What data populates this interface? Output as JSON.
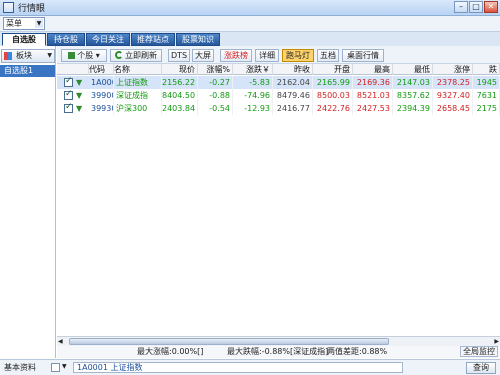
{
  "window": {
    "title": "行情眼"
  },
  "menu": {
    "label": "菜单"
  },
  "tabs": [
    "自选股",
    "持仓股",
    "今日关注",
    "推荐站点",
    "股票知识"
  ],
  "sidebar": {
    "board_label": "板块",
    "items": [
      "自选股1"
    ]
  },
  "toolbar": {
    "stock_btn": "个股",
    "refresh_btn": "立即刷新",
    "buttons": [
      "DTS",
      "大屏",
      "涨跌榜",
      "详细",
      "跑马灯",
      "五档",
      "桌面行情"
    ]
  },
  "table": {
    "columns": [
      "代码",
      "名称",
      "现价",
      "涨幅%",
      "涨跌￥",
      "昨收",
      "开盘",
      "最高",
      "最低",
      "涨停",
      "跌"
    ],
    "rows": [
      [
        "1A0001",
        "上证指数",
        "2156.22",
        "-0.27",
        "-5.83",
        "2162.04",
        "2165.99",
        "2169.36",
        "2147.03",
        "2378.25",
        "1945"
      ],
      [
        "399001",
        "深证成指",
        "8404.50",
        "-0.88",
        "-74.96",
        "8479.46",
        "8500.03",
        "8521.03",
        "8357.62",
        "9327.40",
        "7631"
      ],
      [
        "399300",
        "沪深300",
        "2403.84",
        "-0.54",
        "-12.93",
        "2416.77",
        "2422.76",
        "2427.53",
        "2394.39",
        "2658.45",
        "2175"
      ]
    ]
  },
  "status": {
    "max_rise": "最大涨幅:0.00%[]",
    "max_fall": "最大跌幅:-0.88%[深证成指]",
    "spread": "两值差距:0.88%",
    "global_btn": "全局监控"
  },
  "bottom": {
    "label": "基本资料",
    "code_value": "1A0001 上证指数",
    "query_btn": "查询"
  },
  "colors": {
    "green": "#119a11",
    "red": "#d21f1f",
    "accent": "#2a62b0"
  }
}
